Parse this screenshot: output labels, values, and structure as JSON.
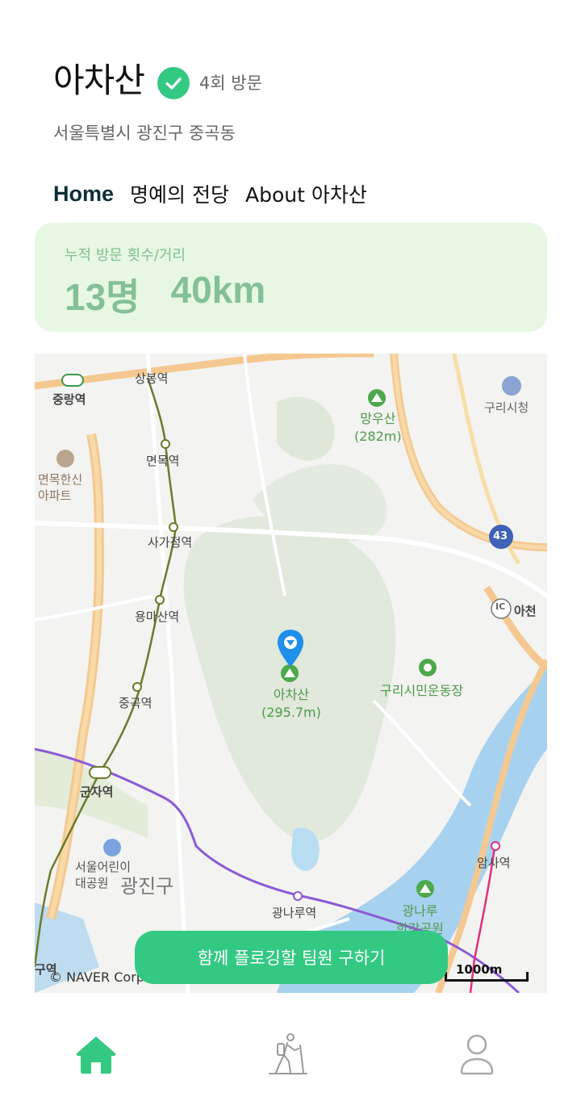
{
  "mountain": {
    "name": "아차산",
    "visits": "4회 방문",
    "address": "서울특별시 광진구 중곡동"
  },
  "tabs": [
    {
      "label": "Home",
      "active": true
    },
    {
      "label": "명예의 전당",
      "active": false
    },
    {
      "label": "About 아차산",
      "active": false
    }
  ],
  "stats": {
    "label": "누적 방문 횟수/거리",
    "people": "13명",
    "distance": "40km"
  },
  "map": {
    "labels": {
      "sangbong": "상봉역",
      "jungnang": "중랑역",
      "myeonmok": "면목역",
      "myeonmok_apt": "면목한신\n아파트",
      "sagajeong": "사가정역",
      "yongmasan": "용마산역",
      "junggok": "중곡역",
      "gunja": "군자역",
      "childrens_park": "서울어린이\n대공원",
      "gwangjin": "광진구",
      "gwangnaru": "광나루역",
      "mangu": "망우산\n(282m)",
      "guri_city": "구리시청",
      "achasan": "아차산\n(295.7m)",
      "guri_stadium": "구리시민운동장",
      "ic": "아천",
      "amsa": "암사역",
      "hangang_park": "광나루\n한강공원",
      "road_43": "43",
      "station_left": "구역"
    },
    "credit": "© NAVER Corp.",
    "scale": "1000m"
  },
  "cta": {
    "label": "함께 플로깅할 팀원 구하기"
  },
  "bottom_nav": {
    "home": "home-icon",
    "hiking": "hiker-icon",
    "profile": "user-icon",
    "accent": "#34c983"
  }
}
